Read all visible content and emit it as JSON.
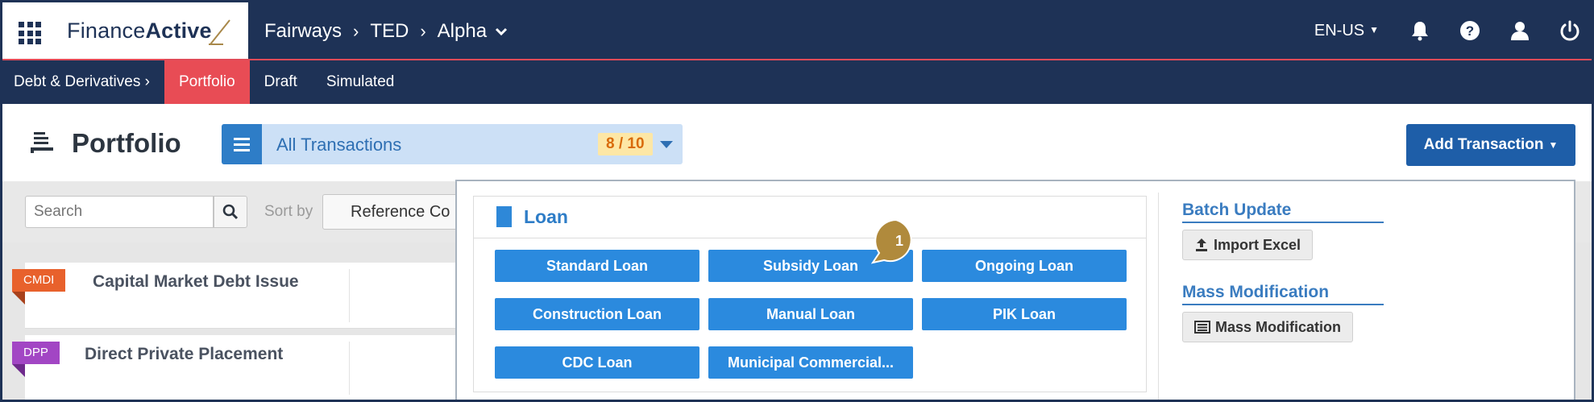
{
  "topbar": {
    "logo_prefix": "Finance",
    "logo_strong": "Active",
    "breadcrumb": [
      "Fairways",
      "TED",
      "Alpha"
    ],
    "language": "EN-US",
    "icons": [
      "apps-grid-icon",
      "bell-icon",
      "help-icon",
      "user-icon",
      "power-icon"
    ]
  },
  "subnav": {
    "items": [
      {
        "label": "Debt & Derivatives ›"
      },
      {
        "label": "Portfolio",
        "active": true
      },
      {
        "label": "Draft"
      },
      {
        "label": "Simulated"
      }
    ]
  },
  "page": {
    "title": "Portfolio",
    "view": {
      "label": "All Transactions",
      "count": "8 / 10"
    },
    "add_button": "Add Transaction"
  },
  "toolbar": {
    "search_placeholder": "Search",
    "sort_label": "Sort by",
    "sort_value": "Reference Co"
  },
  "list": [
    {
      "tag": "CMDI",
      "title": "Capital Market Debt Issue",
      "tag_color": "#e8612c"
    },
    {
      "tag": "DPP",
      "title": "Direct Private Placement",
      "tag_color": "#a246c4"
    }
  ],
  "dropdown": {
    "loan": {
      "title": "Loan",
      "buttons": [
        "Standard Loan",
        "Subsidy Loan",
        "Ongoing Loan",
        "Construction Loan",
        "Manual Loan",
        "PIK Loan",
        "CDC Loan",
        "Municipal Commercial..."
      ]
    },
    "batch_update": {
      "title": "Batch Update",
      "button": "Import Excel"
    },
    "mass_modification": {
      "title": "Mass Modification",
      "button": "Mass Modification"
    }
  },
  "marker": {
    "number": "1"
  },
  "colors": {
    "navy": "#1e3256",
    "active_tab": "#e84c55",
    "primary_blue": "#2b8ade",
    "add_button": "#1e5ea8",
    "marker": "#b08a3c"
  }
}
